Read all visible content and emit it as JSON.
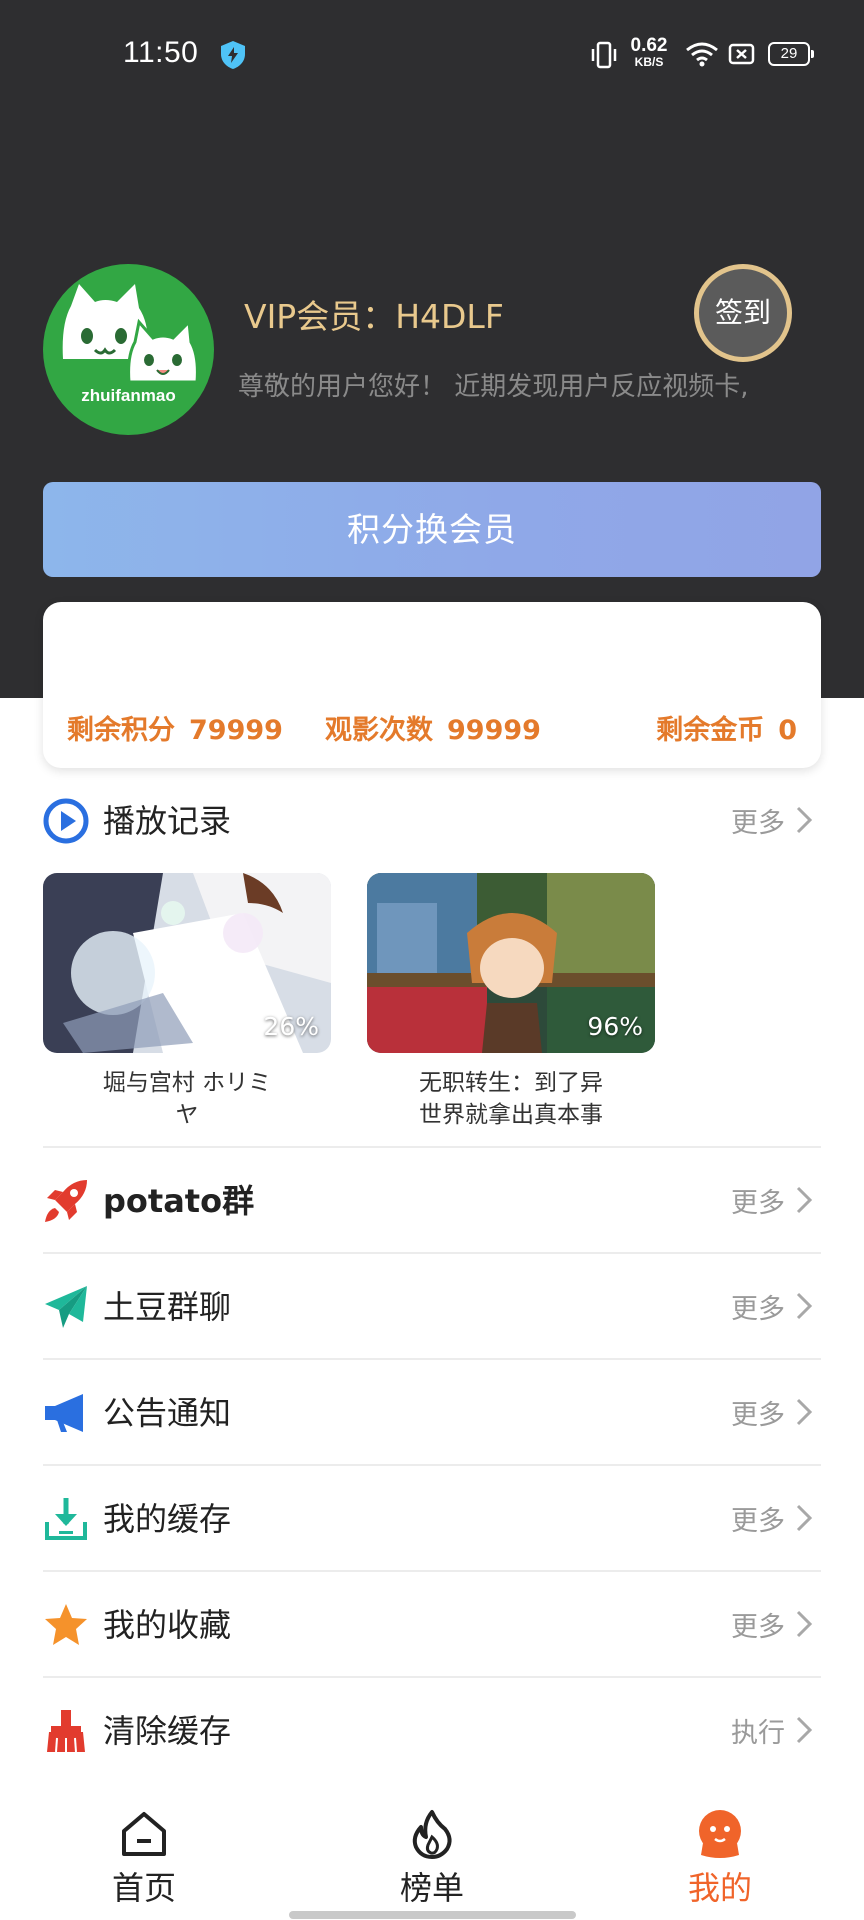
{
  "status_bar": {
    "time": "11:50",
    "net_speed_value": "0.62",
    "net_speed_unit": "KB/S",
    "battery": "29"
  },
  "profile": {
    "avatar_text": "zhuifanmao",
    "vip_label": "VIP会员：H4DLF",
    "notice": "尊敬的用户您好！ 近期发现用户反应视频卡,",
    "checkin_label": "签到"
  },
  "points_button": "积分换会员",
  "stats": {
    "points_label": "剩余积分",
    "points_value": "79999",
    "views_label": "观影次数",
    "views_value": "99999",
    "coins_label": "剩余金币",
    "coins_value": "0"
  },
  "history": {
    "title": "播放记录",
    "more": "更多",
    "items": [
      {
        "title": "堀与宫村 ホリミヤ",
        "progress": "26%"
      },
      {
        "title": "无职转生：到了异世界就拿出真本事",
        "progress": "96%"
      }
    ]
  },
  "menu": [
    {
      "title": "potato群",
      "action": "更多",
      "icon": "rocket-icon"
    },
    {
      "title": "土豆群聊",
      "action": "更多",
      "icon": "paper-plane-icon"
    },
    {
      "title": "公告通知",
      "action": "更多",
      "icon": "megaphone-icon"
    },
    {
      "title": "我的缓存",
      "action": "更多",
      "icon": "download-icon"
    },
    {
      "title": "我的收藏",
      "action": "更多",
      "icon": "star-icon"
    },
    {
      "title": "清除缓存",
      "action": "执行",
      "icon": "broom-icon"
    }
  ],
  "bottom_nav": [
    {
      "label": "首页",
      "icon": "home-icon"
    },
    {
      "label": "榜单",
      "icon": "flame-icon"
    },
    {
      "label": "我的",
      "icon": "profile-icon",
      "active": true
    }
  ],
  "colors": {
    "header_bg": "#2e2e30",
    "gold": "#e9c98d",
    "stat_orange": "#e47a2b",
    "active_orange": "#f0642a"
  }
}
